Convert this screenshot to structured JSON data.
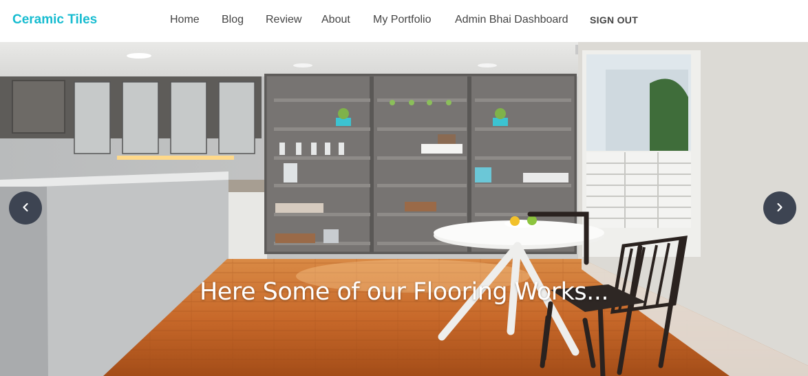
{
  "navbar": {
    "brand": "Ceramic Tiles",
    "links": [
      "Home",
      "Blog",
      "Review",
      "About",
      "My Portfolio",
      "Admin Bhai Dashboard"
    ],
    "sign_out": "SIGN OUT"
  },
  "hero": {
    "caption": "Here Some of our Flooring Works...",
    "prev_icon": "chevron-left-icon",
    "next_icon": "chevron-right-icon"
  },
  "colors": {
    "brand": "#17bcd0",
    "nav_text": "#444444",
    "carousel_button": "#3d4452",
    "floor": "#c8692a"
  }
}
